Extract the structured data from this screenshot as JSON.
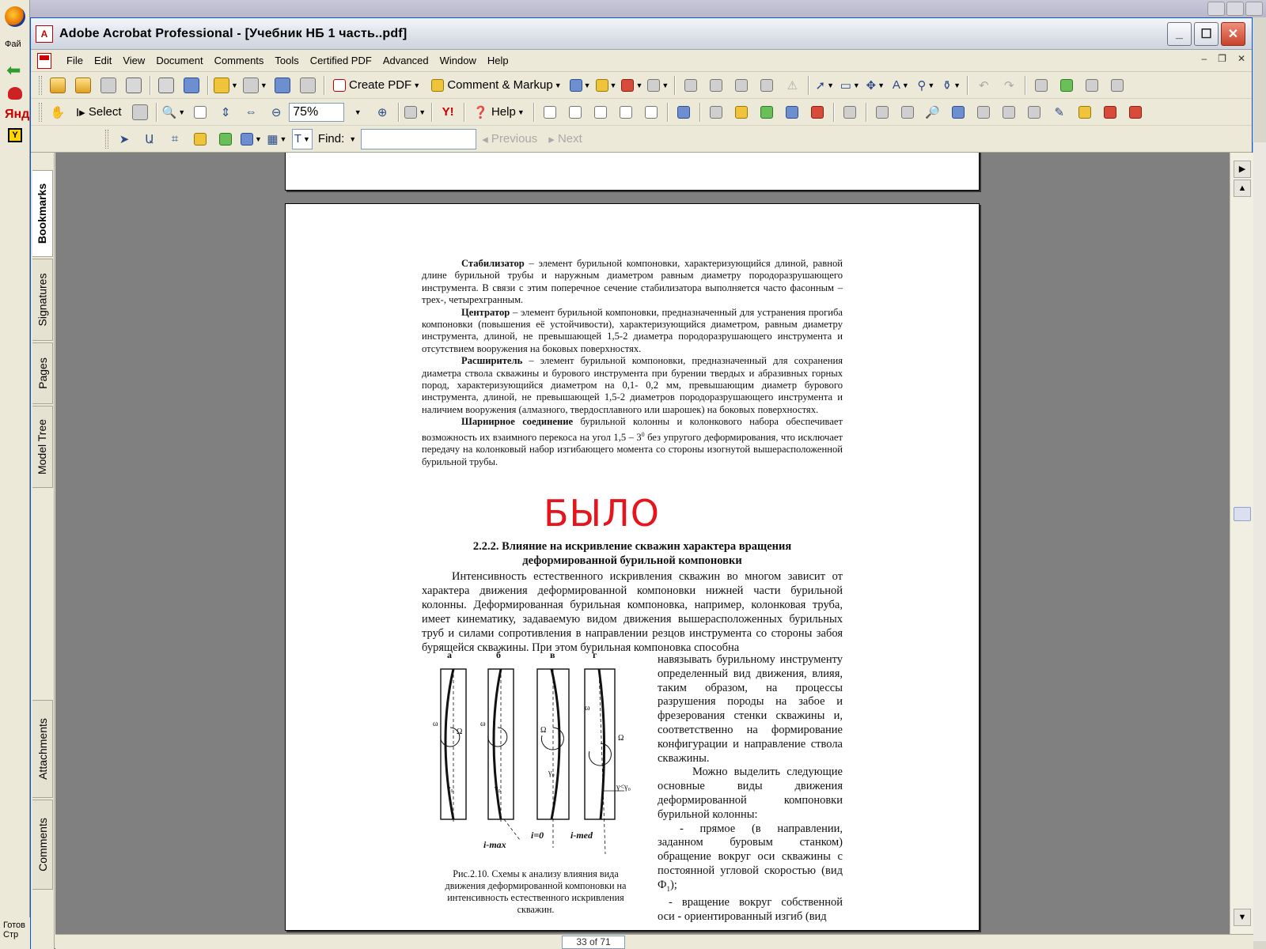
{
  "background_window": {
    "left_labels": [
      "Фай",
      "Я",
      "Готов",
      "Стр"
    ],
    "yandex": "Янде",
    "ybox": "Y"
  },
  "window": {
    "title": "Adobe Acrobat Professional - [Учебник НБ 1 часть..pdf]",
    "icon_text": "A"
  },
  "menu": {
    "items": [
      "File",
      "Edit",
      "View",
      "Document",
      "Comments",
      "Tools",
      "Certified PDF",
      "Advanced",
      "Window",
      "Help"
    ]
  },
  "toolbar1": {
    "create_pdf": "Create PDF",
    "comment_markup": "Comment & Markup"
  },
  "toolbar2": {
    "select": "Select",
    "zoom": "75%",
    "help": "Help"
  },
  "toolbar3": {
    "find_label": "Find:",
    "find_value": "",
    "previous": "Previous",
    "next": "Next"
  },
  "nav_tabs": [
    "Bookmarks",
    "Signatures",
    "Pages",
    "Model Tree",
    "Attachments",
    "Comments"
  ],
  "document": {
    "para1_term": "Стабилизатор",
    "para1_text": " – элемент бурильной компоновки, характеризующийся длиной, равной длине бурильной трубы и наружным диаметром равным диаметру породоразрушающего инструмента. В связи с этим поперечное сечение стабилизатора выполняется часто фасонным – трех-, четырехгранным.",
    "para2_term": "Центратор",
    "para2_text": " – элемент бурильной компоновки, предназначенный для устранения прогиба компоновки (повышения её устойчивости), характеризующийся диаметром, равным диаметру инструмента, длиной, не превышающей 1,5-2 диаметра породоразрушающего инструмента и отсутствием вооружения на боковых поверхностях.",
    "para3_term": "Расширитель",
    "para3_text": " – элемент бурильной компоновки, предназначенный для сохранения диаметра ствола скважины и бурового инструмента при бурении твердых и абразивных горных пород, характеризующийся диаметром на 0,1- 0,2 мм, превышающим диаметр бурового инструмента, длиной, не превышающей 1,5-2 диаметров породоразрушающего инструмента и наличием вооружения (алмазного, твердосплавного или шарошек) на боковых поверхностях.",
    "para4_term": "Шарнирное соединение",
    "para4_text_a": " бурильной колонны и колонкового набора обеспечивает возможность их взаимного перекоса на угол 1,5 – 3",
    "para4_sup": "0",
    "para4_text_b": " без упругого деформирования, что исключает передачу на колонковый набор изгибающего момента со стороны изогнутой вышерасположенной бурильной трубы.",
    "watermark": "БЫЛО",
    "heading_line1": "2.2.2. Влияние на искривление скважин характера вращения",
    "heading_line2": "деформированной бурильной компоновки",
    "body": "Интенсивность естественного искривления скважин во многом зависит от характера движения деформированной компоновки нижней части бурильной колонны. Деформированная бурильная компоновка, например, колонковая труба, имеет кинематику, задаваемую видом движения вышерасположенных бурильных труб и силами сопротивления в направлении резцов инструмента со стороны забоя бурящейся скважины. При этом бурильная компоновка способна",
    "right_col_1": "навязывать бурильному инструменту определенный вид движения, влияя, таким образом, на процессы разрушения породы на забое и фрезерования стенки скважины и, соответственно на формирование конфигурации и направление ствола скважины.",
    "right_col_2": "Можно выделить следующие основные виды движения деформированной компоновки бурильной колонны:",
    "right_col_3": "- прямое (в направлении, заданном буровым станком) обращение вокруг оси скважины с постоянной угловой скоростью (вид Ф",
    "right_col_3_sub": "1",
    "right_col_3_end": ");",
    "right_col_4": "- вращение вокруг собственной оси - ориентированный изгиб (вид",
    "figure_labels": [
      "а",
      "б",
      "в",
      "г"
    ],
    "figure_bottom_labels": [
      "i-max",
      "i=0",
      "i-med"
    ],
    "figure_symbols": {
      "omega": "ω",
      "Omega": "Ω",
      "gamma0": "γ₀",
      "gamma_rel": "γ<γ₀"
    },
    "caption": "Рис.2.10. Схемы к анализу влияния вида движения деформированной компоновки на интенсивность естественного искривления скважин.",
    "page_number": "33"
  },
  "status": {
    "page_display": "33 of 71"
  },
  "colors": {
    "watermark": "#e8141c",
    "titlebar_close": "#c8432a",
    "doc_background": "#808080"
  }
}
